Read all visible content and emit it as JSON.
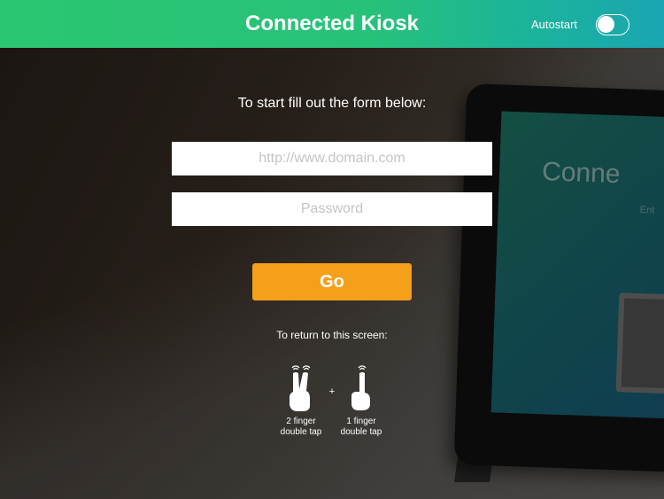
{
  "header": {
    "title": "Connected Kiosk",
    "autostart_label": "Autostart",
    "autostart_on": false
  },
  "form": {
    "intro": "To start fill out the form below:",
    "url_placeholder": "http://www.domain.com",
    "password_placeholder": "Password",
    "go_label": "Go"
  },
  "return_hint": {
    "text": "To return to this screen:",
    "plus": "+",
    "two_finger_line1": "2 finger",
    "two_finger_line2": "double tap",
    "one_finger_line1": "1 finger",
    "one_finger_line2": "double tap"
  },
  "background": {
    "tablet_title": "Conne",
    "tablet_sub": "Ent"
  },
  "colors": {
    "header_start": "#2bc671",
    "header_end": "#1aa6b2",
    "go_button": "#f5a01a"
  }
}
